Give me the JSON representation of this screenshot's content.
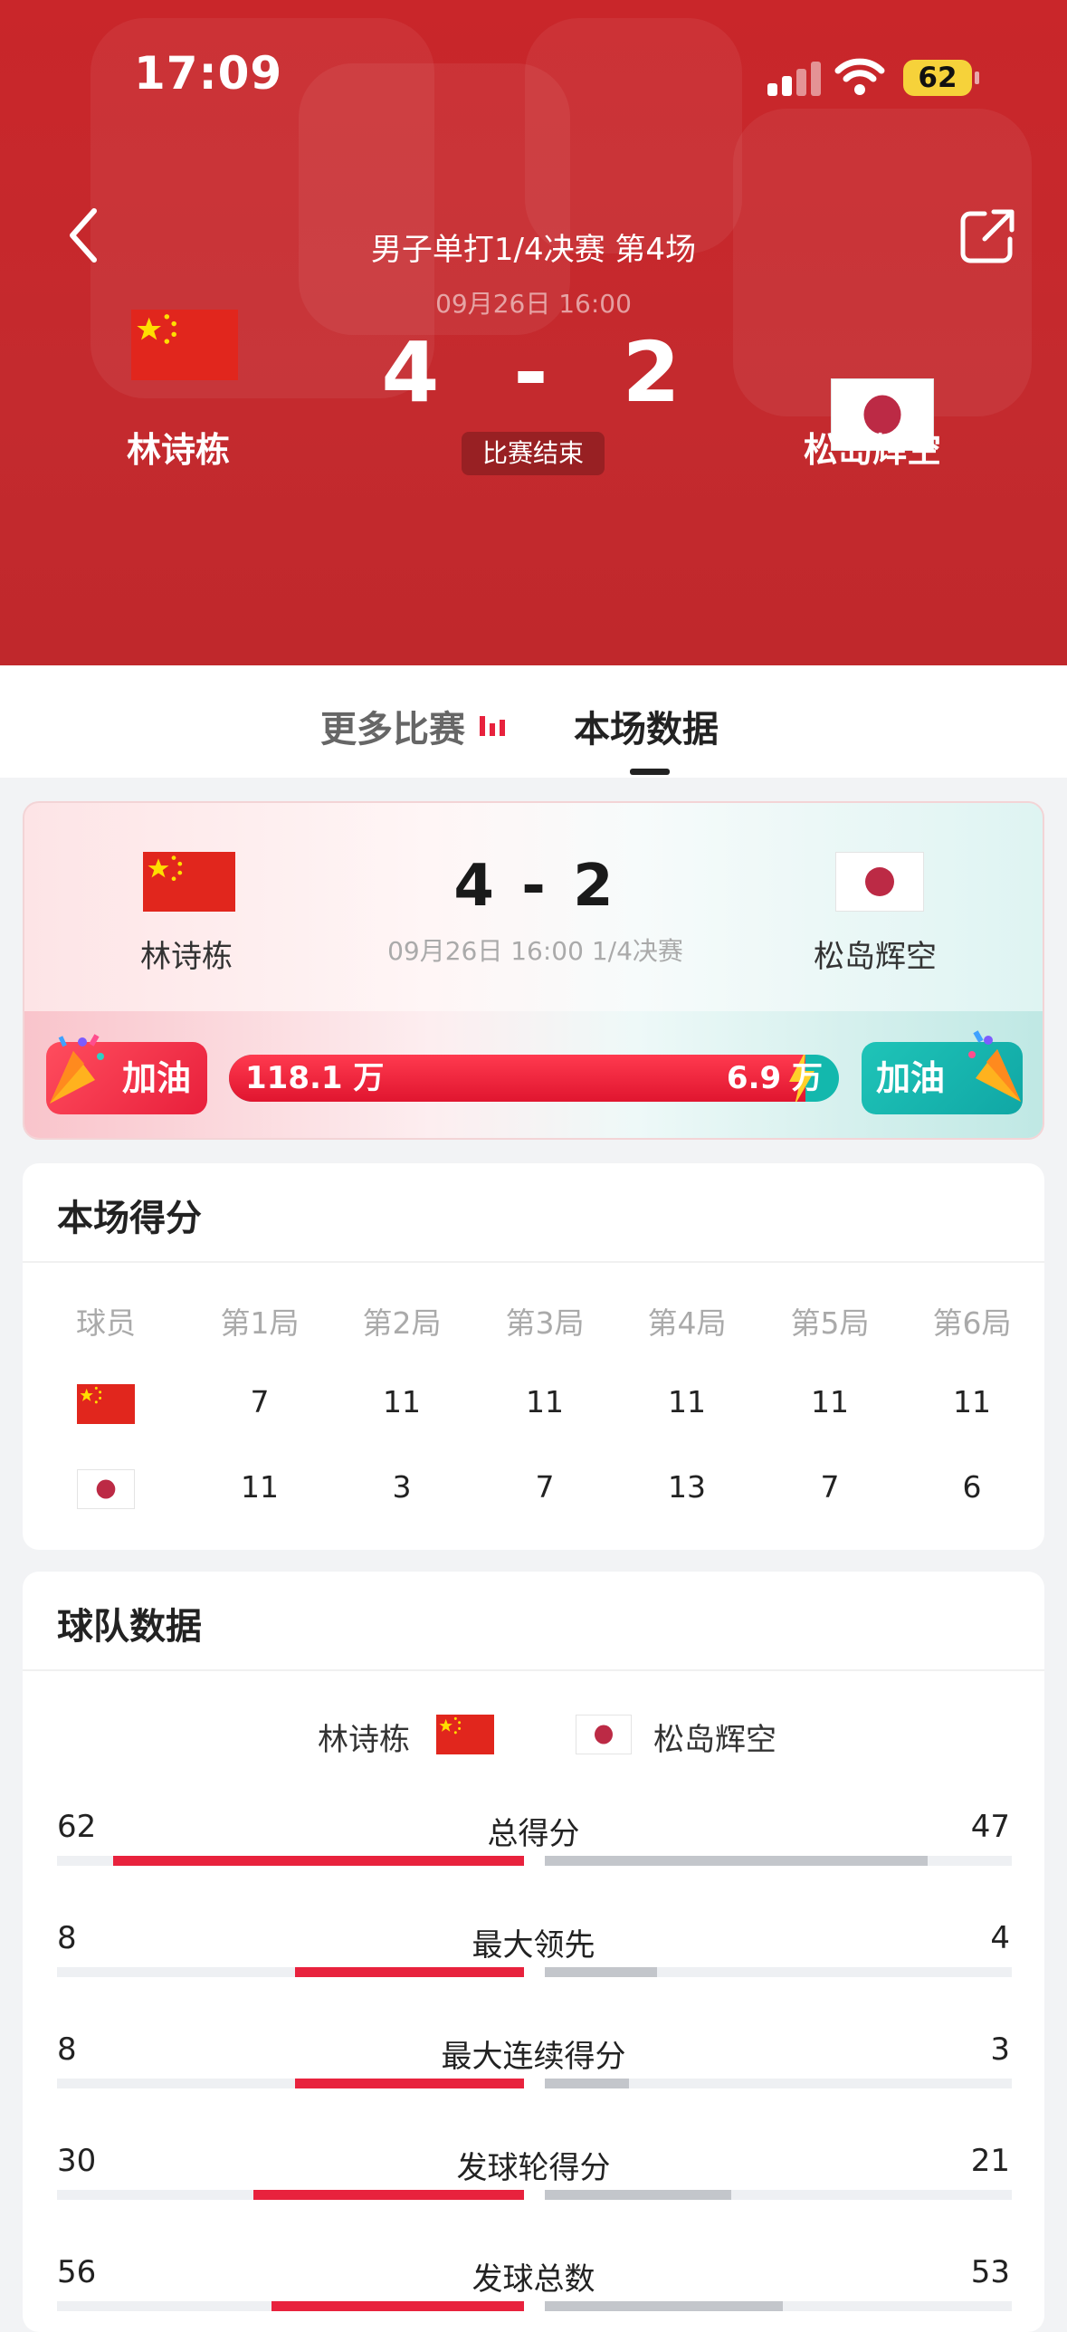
{
  "status_bar": {
    "time": "17:09",
    "battery": "62"
  },
  "header": {
    "match_title": "男子单打1/4决赛 第4场",
    "match_time": "09月26日 16:00",
    "score_left": "4",
    "score_sep": "-",
    "score_right": "2",
    "status": "比赛结束",
    "player_left": "林诗栋",
    "player_right": "松岛辉空"
  },
  "tabs": {
    "more": "更多比赛",
    "this": "本场数据"
  },
  "summary": {
    "player_left": "林诗栋",
    "player_right": "松岛辉空",
    "score": "4 - 2",
    "info": "09月26日 16:00 1/4决赛",
    "cheer_label": "加油",
    "support_left": "118.1 万",
    "support_right": "6.9 万",
    "support_left_share": 0.945
  },
  "score_table": {
    "title": "本场得分",
    "headers": [
      "球员",
      "第1局",
      "第2局",
      "第3局",
      "第4局",
      "第5局",
      "第6局"
    ],
    "rows": [
      {
        "team": "china",
        "games": [
          "7",
          "11",
          "11",
          "11",
          "11",
          "11"
        ]
      },
      {
        "team": "japan",
        "games": [
          "11",
          "3",
          "7",
          "13",
          "7",
          "6"
        ]
      }
    ]
  },
  "team_stats": {
    "title": "球队数据",
    "legend_left": "林诗栋",
    "legend_right": "松岛辉空",
    "stats": [
      {
        "label": "总得分",
        "left": "62",
        "right": "47",
        "left_ratio": 0.88,
        "right_ratio": 0.82
      },
      {
        "label": "最大领先",
        "left": "8",
        "right": "4",
        "left_ratio": 0.49,
        "right_ratio": 0.24
      },
      {
        "label": "最大连续得分",
        "left": "8",
        "right": "3",
        "left_ratio": 0.49,
        "right_ratio": 0.18
      },
      {
        "label": "发球轮得分",
        "left": "30",
        "right": "21",
        "left_ratio": 0.58,
        "right_ratio": 0.4
      },
      {
        "label": "发球总数",
        "left": "56",
        "right": "53",
        "left_ratio": 0.54,
        "right_ratio": 0.51
      }
    ]
  },
  "colors": {
    "hero": "#c9262a",
    "accent_red": "#e8223d",
    "accent_teal": "#13b8ad",
    "neutral_bar": "#c3c6cb"
  }
}
